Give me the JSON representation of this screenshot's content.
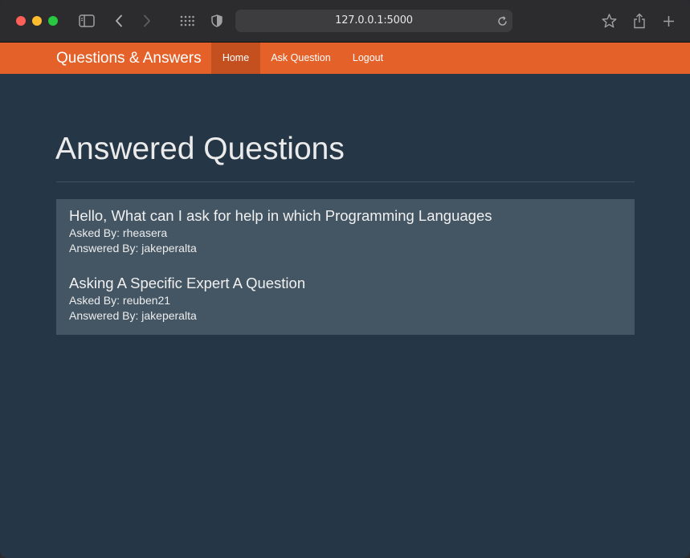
{
  "browser": {
    "url": "127.0.0.1:5000"
  },
  "navbar": {
    "brand": "Questions & Answers",
    "items": [
      {
        "label": "Home",
        "active": true
      },
      {
        "label": "Ask Question",
        "active": false
      },
      {
        "label": "Logout",
        "active": false
      }
    ]
  },
  "main": {
    "title": "Answered Questions",
    "asked_by_prefix": "Asked By: ",
    "answered_by_prefix": "Answered By: ",
    "questions": [
      {
        "title": "Hello, What can I ask for help in which Programming Languages",
        "asked_by": "Asked By: rheasera",
        "answered_by": "Answered By: jakeperalta"
      },
      {
        "title": "Asking A Specific Expert A Question",
        "asked_by": "Asked By: reuben21",
        "answered_by": "Answered By: jakeperalta"
      }
    ]
  },
  "colors": {
    "navbar": "#e4622a",
    "navbar_active": "#c4501f",
    "background": "#253646",
    "card": "#445664"
  },
  "icons": [
    "sidebar-icon",
    "back-icon",
    "forward-icon",
    "grid-icon",
    "shield-icon",
    "reload-icon",
    "star-icon",
    "share-icon",
    "new-tab-icon"
  ]
}
